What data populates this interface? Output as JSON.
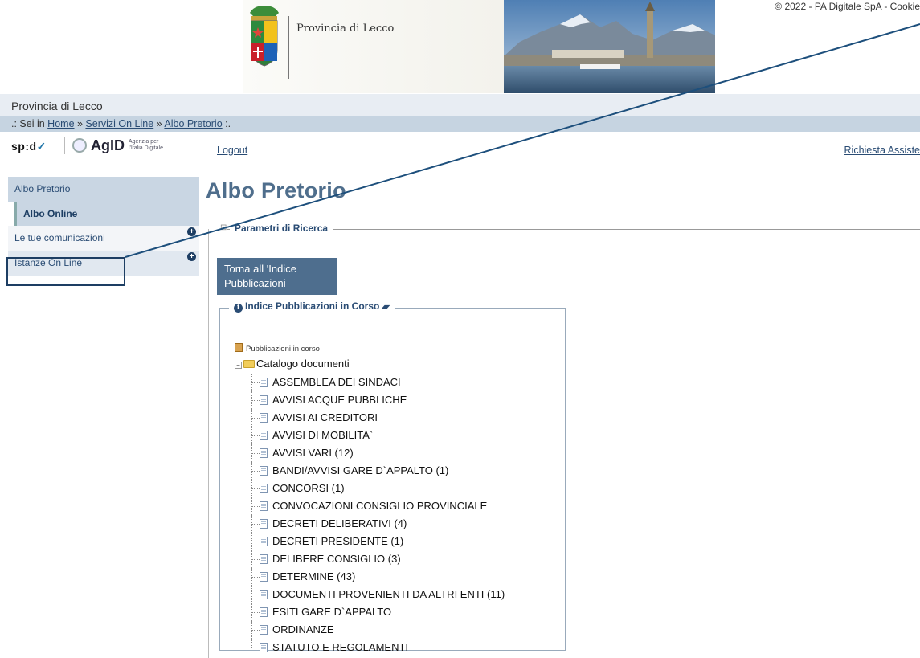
{
  "header": {
    "banner_title": "Provincia di Lecco",
    "copyright": "© 2022 - PA Digitale SpA - Cookie"
  },
  "site": {
    "name": "Provincia di Lecco"
  },
  "breadcrumb": {
    "prefix": ".: Sei in ",
    "items": [
      "Home",
      "Servizi On Line",
      "Albo Pretorio"
    ],
    "separator": " » ",
    "suffix": " :."
  },
  "toolbar": {
    "spid_label": "sp:d",
    "agid_label": "AgID",
    "agid_sub": "Agenzia per l'Italia Digitale",
    "logout_label": "Logout",
    "assist_label": "Richiesta Assiste"
  },
  "sidebar": {
    "items": [
      {
        "label": "Albo Pretorio"
      },
      {
        "label": "Albo Online"
      },
      {
        "label": "Le tue comunicazioni",
        "expander": "+"
      },
      {
        "label": "Istanze On Line",
        "expander": "+"
      }
    ]
  },
  "main": {
    "title": "Albo Pretorio",
    "params_label": "Parametri di Ricerca",
    "params_toggle": "⊟",
    "back_button_label": "Torna all 'Indice Pubblicazioni",
    "index_legend": "Indice Pubblicazioni in Corso",
    "info_glyph": "i",
    "eraser_glyph": "▰",
    "tree": {
      "root_label": "Pubblicazioni in corso",
      "catalog_label": "Catalogo documenti",
      "expand_glyph": "−",
      "items": [
        "ASSEMBLEA DEI SINDACI",
        "AVVISI ACQUE PUBBLICHE",
        "AVVISI AI CREDITORI",
        "AVVISI DI MOBILITA`",
        "AVVISI VARI (12)",
        "BANDI/AVVISI GARE D`APPALTO (1)",
        "CONCORSI (1)",
        "CONVOCAZIONI CONSIGLIO PROVINCIALE",
        "DECRETI DELIBERATIVI (4)",
        "DECRETI PRESIDENTE (1)",
        "DELIBERE CONSIGLIO (3)",
        "DETERMINE (43)",
        "DOCUMENTI PROVENIENTI DA ALTRI ENTI (11)",
        "ESITI GARE D`APPALTO",
        "ORDINANZE",
        "STATUTO E REGOLAMENTI"
      ]
    }
  },
  "colors": {
    "accent": "#1d3e63",
    "title": "#4f6e8c",
    "button_bg": "#4e6e8e",
    "breadcrumb_bar": "#c6d4e1"
  }
}
